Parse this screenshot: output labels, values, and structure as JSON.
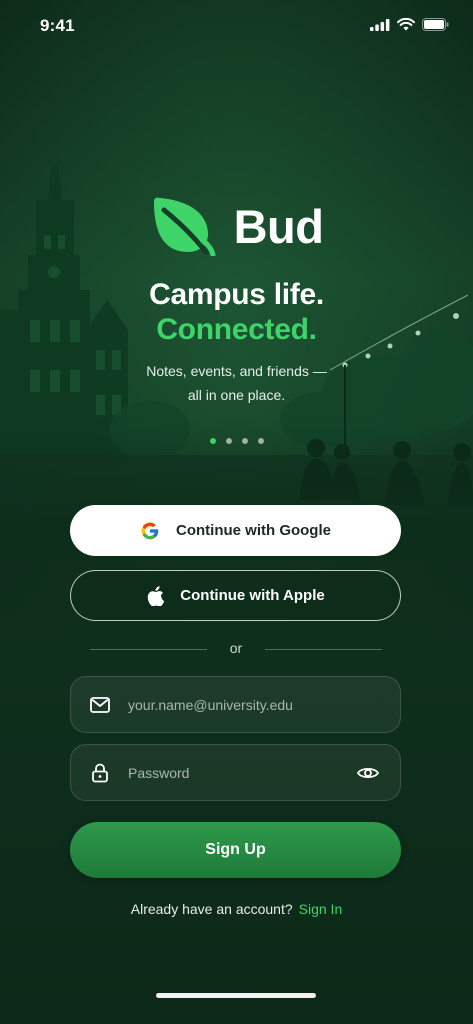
{
  "status_bar": {
    "time": "9:41"
  },
  "brand": {
    "name": "Bud",
    "logo_icon": "leaf-icon",
    "accent": "#3fd46a"
  },
  "hero": {
    "headline_line1": "Campus life.",
    "headline_line2": "Connected.",
    "tagline_line1": "Notes, events, and friends —",
    "tagline_line2": "all in one place.",
    "carousel": {
      "total": 4,
      "active_index": 0
    }
  },
  "auth": {
    "google_label": "Continue with Google",
    "apple_label": "Continue with Apple",
    "divider_text": "or",
    "email_placeholder": "your.name@university.edu",
    "password_placeholder": "Password",
    "signup_label": "Sign Up"
  },
  "footer": {
    "prompt": "Already have an account?",
    "signin_link": "Sign In"
  },
  "colors": {
    "background": "#0f2f1d",
    "accent_green": "#3fd46a",
    "primary_button": "#279043"
  }
}
